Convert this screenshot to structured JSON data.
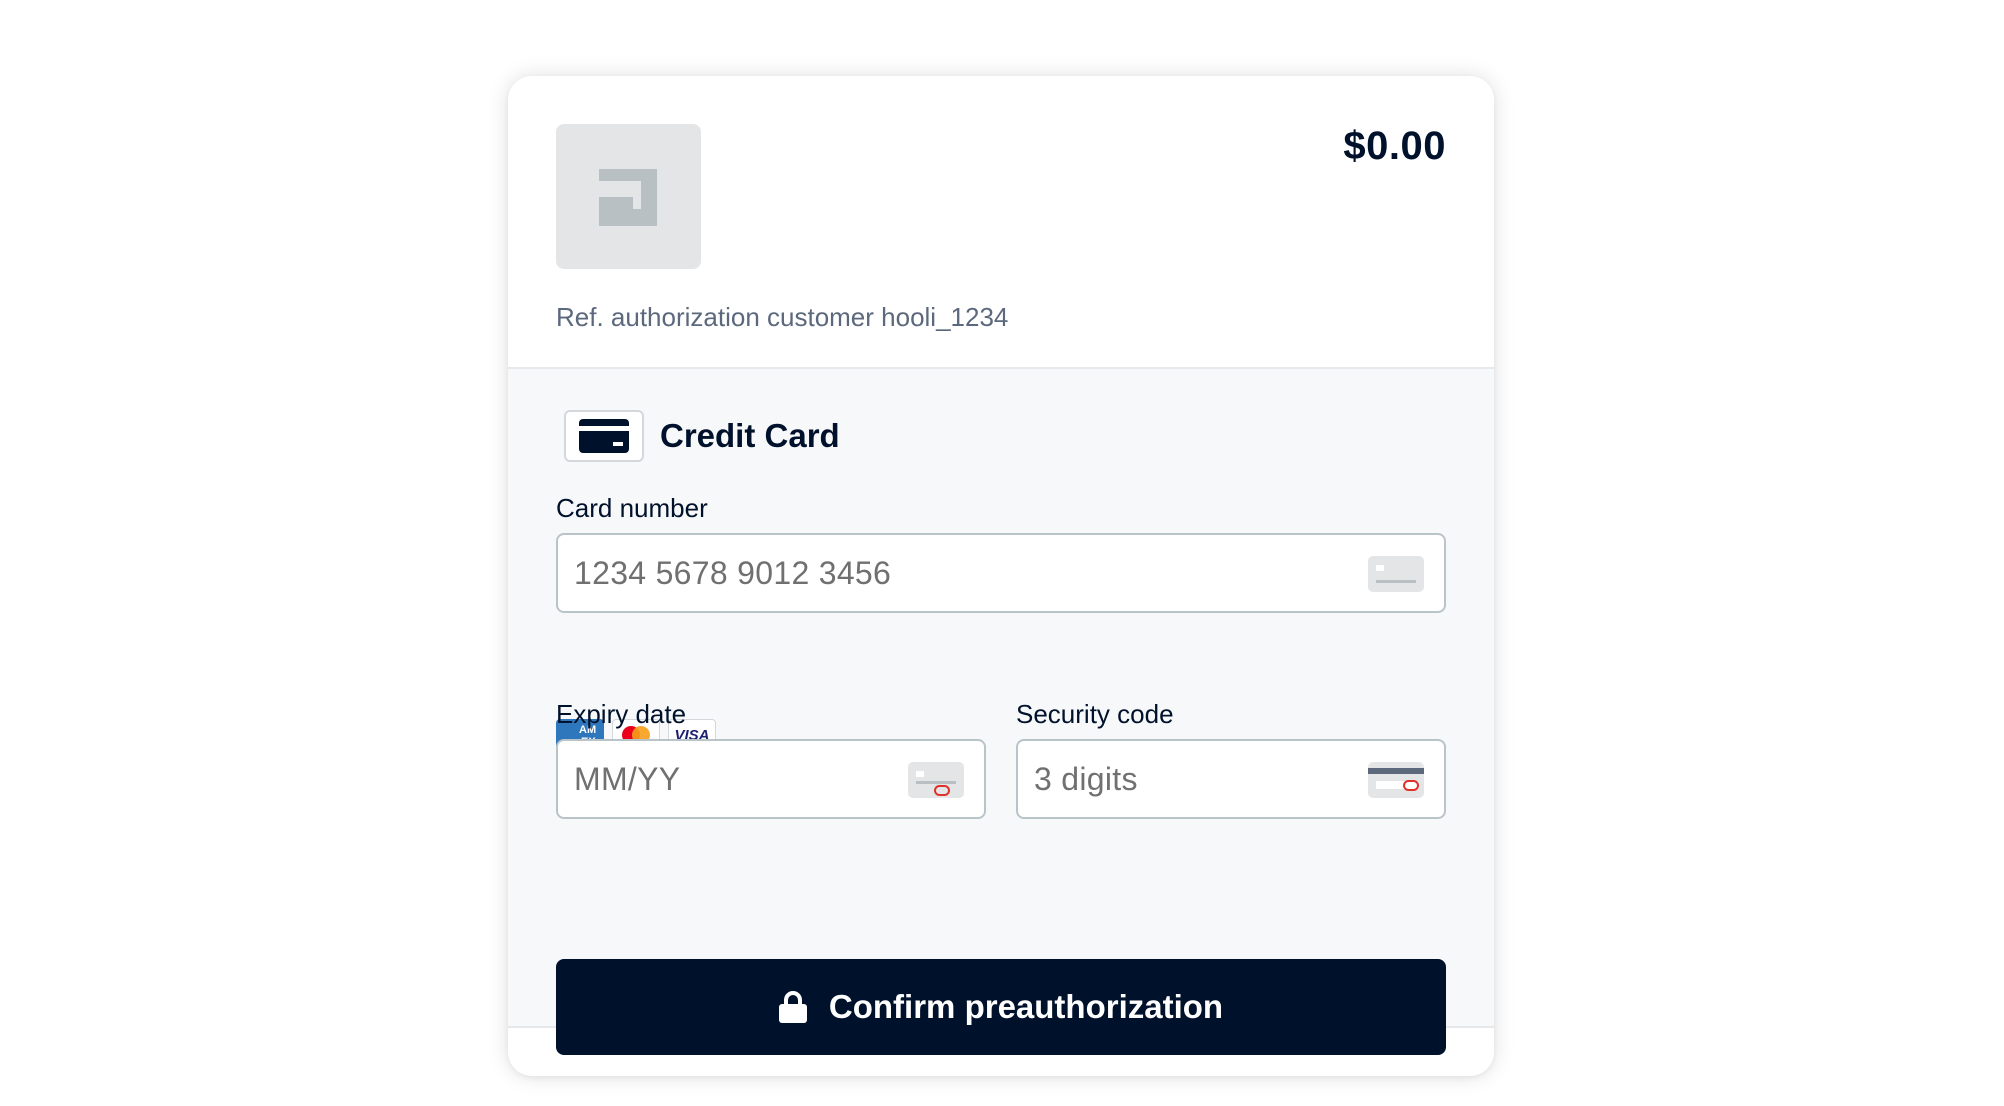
{
  "header": {
    "amount": "$0.00",
    "reference": "Ref. authorization customer hooli_1234",
    "logo_icon": "merchant-logo-icon"
  },
  "payment_method": {
    "label": "Credit Card",
    "icon": "credit-card-icon"
  },
  "card_number": {
    "label": "Card number",
    "placeholder": "1234 5678 9012 3456",
    "icon": "card-front-icon"
  },
  "brands": [
    {
      "name": "amex-icon",
      "text": "AM EX"
    },
    {
      "name": "mastercard-icon"
    },
    {
      "name": "visa-icon",
      "text": "VISA"
    }
  ],
  "expiry": {
    "label": "Expiry date",
    "placeholder": "MM/YY",
    "icon": "card-expiry-icon"
  },
  "security": {
    "label": "Security code",
    "placeholder": "3 digits",
    "icon": "card-cvc-icon"
  },
  "submit": {
    "label": "Confirm preauthorization",
    "icon": "lock-icon"
  },
  "colors": {
    "primary": "#00112c",
    "page_background": "#ffffff",
    "form_background": "#f7f8f9",
    "field_border": "#b9c4c9",
    "muted_text": "#5c687c",
    "amex_blue": "#2e77bc",
    "mastercard_red": "#eb001b",
    "mastercard_orange": "#f79e1b",
    "visa_blue": "#1a1f71"
  }
}
